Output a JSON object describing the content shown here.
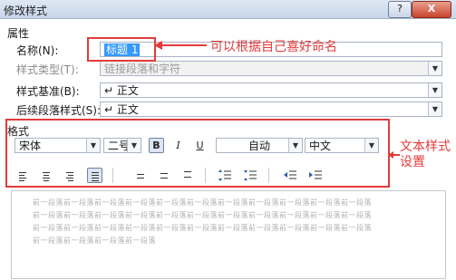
{
  "window": {
    "title": "修改样式",
    "help": "?",
    "close": "X"
  },
  "properties": {
    "section": "属性",
    "name_label": "名称(N):",
    "name_value": "标题 1",
    "type_label": "样式类型(T):",
    "type_value": "链接段落和字符",
    "base_label": "样式基准(B):",
    "base_value": "↵ 正文",
    "next_label": "后续段落样式(S):",
    "next_value": "↵ 正文"
  },
  "format": {
    "section": "格式",
    "font": "宋体",
    "size": "二号",
    "bold": "B",
    "italic": "I",
    "underline": "U",
    "color": "自动",
    "language": "中文"
  },
  "annotations": {
    "name_note": "可以根据自己喜好命名",
    "format_note_line1": "文本样式",
    "format_note_line2": "设置"
  },
  "preview": {
    "line1": "前一段落前一段落前一段落前一段落前一段落前一段落前一段落前一段落前一段落前一段落前一段落",
    "line2": "前一段落前一段落前一段落前一段落前一段落前一段落前一段落前一段落前一段落前一段落前一段落",
    "line3": "前一段落前一段落前一段落前一段落前一段落前一段落前一段落前一段落前一段落前一段落前一段落",
    "line4": "前一段落前一段落前一段落前一段落"
  },
  "colors": {
    "annotation": "#e23b3b",
    "selection": "#3399ff"
  }
}
